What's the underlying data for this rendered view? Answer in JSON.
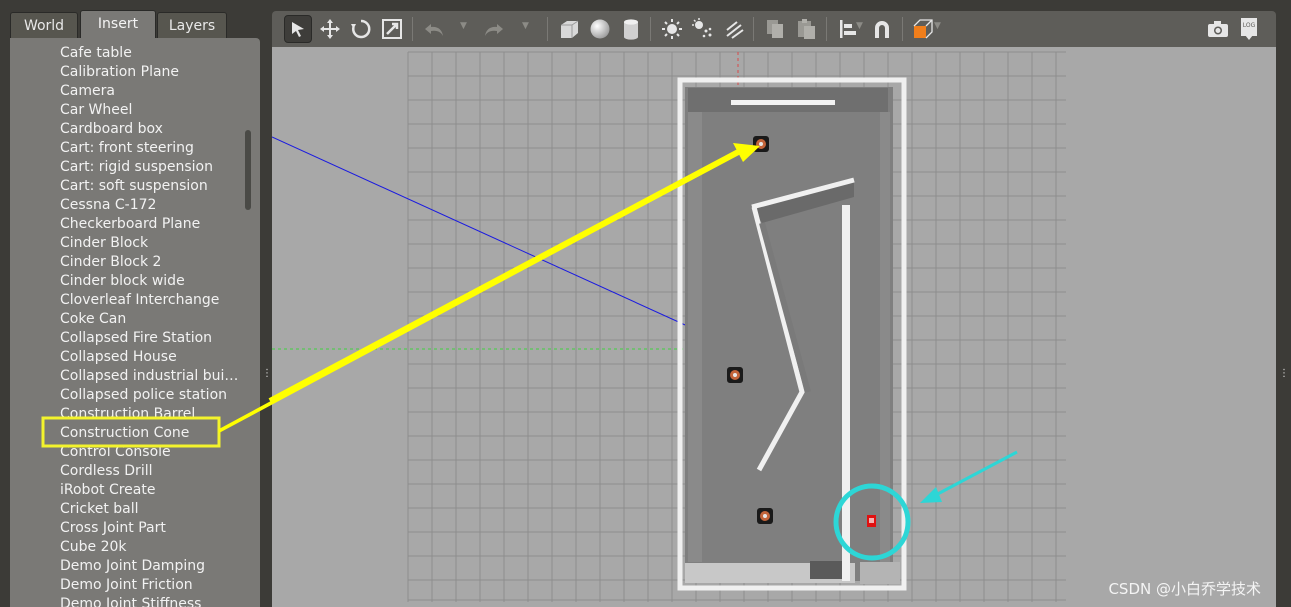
{
  "tabs": {
    "world": "World",
    "insert": "Insert",
    "layers": "Layers"
  },
  "models": [
    "Cafe table",
    "Calibration Plane",
    "Camera",
    "Car Wheel",
    "Cardboard box",
    "Cart: front steering",
    "Cart: rigid suspension",
    "Cart: soft suspension",
    "Cessna C-172",
    "Checkerboard Plane",
    "Cinder Block",
    "Cinder Block 2",
    "Cinder block wide",
    "Cloverleaf Interchange",
    "Coke Can",
    "Collapsed Fire Station",
    "Collapsed House",
    "Collapsed industrial buil…",
    "Collapsed police station",
    "Construction Barrel",
    "Construction Cone",
    "Control Console",
    "Cordless Drill",
    "iRobot Create",
    "Cricket ball",
    "Cross Joint Part",
    "Cube 20k",
    "Demo Joint Damping",
    "Demo Joint Friction",
    "Demo Joint Stiffness"
  ],
  "highlighted_model": "Construction Cone",
  "toolbar": {
    "log_label": "LOG"
  },
  "colors": {
    "arrow_yellow": "#ffff00",
    "arrow_cyan": "#2dd6d6",
    "robot_red": "#e01010",
    "accent_orange": "#f07e1b"
  },
  "watermark": "CSDN @小白乔学技术"
}
